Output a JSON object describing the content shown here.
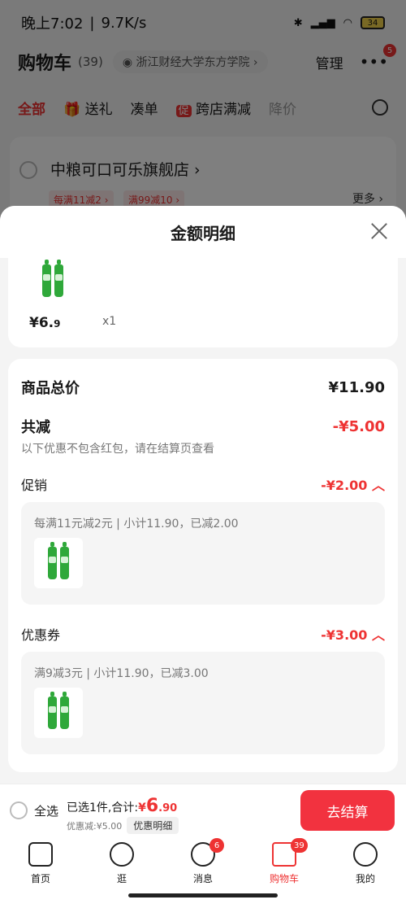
{
  "status": {
    "time": "晚上7:02",
    "speed": "9.7K/s",
    "battery": "34"
  },
  "header": {
    "title": "购物车",
    "count": "(39)",
    "campus": "浙江财经大学东方学院",
    "manage": "管理",
    "more_badge": "5"
  },
  "filters": [
    {
      "label": "全部",
      "state": "active"
    },
    {
      "label": "送礼",
      "state": ""
    },
    {
      "label": "凑单",
      "state": ""
    },
    {
      "label": "跨店满减",
      "state": ""
    },
    {
      "label": "降价",
      "state": "muted"
    }
  ],
  "store": {
    "name": "中粮可口可乐旗舰店",
    "tag1": "每满11减2",
    "tag2": "满99减10",
    "more": "更多"
  },
  "sheet": {
    "title": "金额明细",
    "product": {
      "price_int": "¥6.",
      "price_dec": "9",
      "qty": "x1"
    },
    "total_label": "商品总价",
    "total_value": "¥11.90",
    "cut_label": "共减",
    "cut_value": "-¥5.00",
    "note": "以下优惠不包含红包，请在结算页查看",
    "promo": {
      "label": "促销",
      "value": "-¥2.00",
      "desc": "每满11元减2元 | 小计11.90，已减2.00"
    },
    "coupon": {
      "label": "优惠券",
      "value": "-¥3.00",
      "desc": "满9减3元 | 小计11.90，已减3.00"
    }
  },
  "checkout": {
    "select_all": "全选",
    "selected_prefix": "已选1件,合计:",
    "currency": "¥",
    "amount_int": "6",
    "amount_dec": ".90",
    "discount": "优惠减:¥5.00",
    "detail_chip": "优惠明细",
    "button": "去结算"
  },
  "tabs": [
    {
      "label": "首页"
    },
    {
      "label": "逛"
    },
    {
      "label": "消息",
      "badge": "6"
    },
    {
      "label": "购物车",
      "badge": "39"
    },
    {
      "label": "我的"
    }
  ]
}
